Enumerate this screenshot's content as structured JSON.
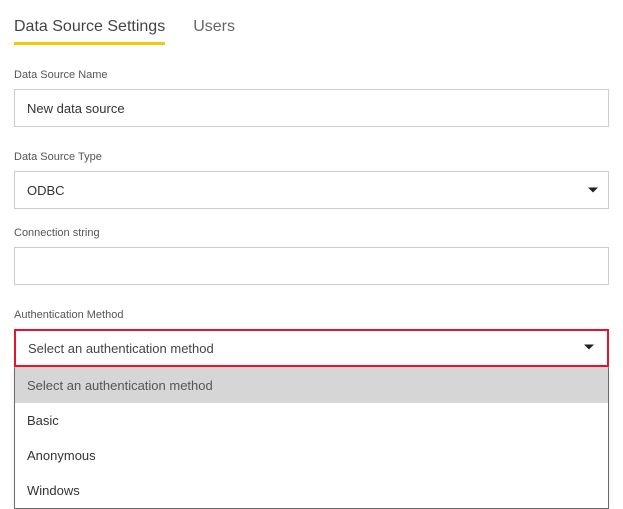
{
  "tabs": {
    "settings": "Data Source Settings",
    "users": "Users"
  },
  "fields": {
    "dataSourceName": {
      "label": "Data Source Name",
      "value": "New data source"
    },
    "dataSourceType": {
      "label": "Data Source Type",
      "selected": "ODBC"
    },
    "connectionString": {
      "label": "Connection string",
      "value": ""
    },
    "authMethod": {
      "label": "Authentication Method",
      "selected": "Select an authentication method",
      "options": {
        "placeholder": "Select an authentication method",
        "basic": "Basic",
        "anonymous": "Anonymous",
        "windows": "Windows"
      }
    }
  }
}
